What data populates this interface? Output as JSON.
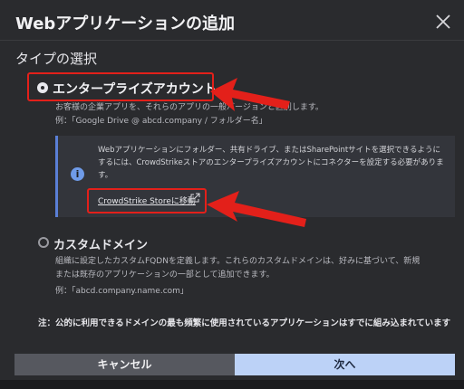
{
  "dialog": {
    "title": "Webアプリケーションの追加",
    "section_title": "タイプの選択",
    "close_icon": "close-icon"
  },
  "option_enterprise": {
    "label": "エンタープライズアカウント",
    "selected": true,
    "description": "お客様の企業アプリを、それらのアプリの一般バージョンと区別します。",
    "example": "例：「Google Drive @ abcd.company / フォルダー名」",
    "info": {
      "icon": "info-icon",
      "text": "Webアプリケーションにフォルダー、共有ドライブ、またはSharePointサイトを選択できるようにするには、CrowdStrikeストアのエンタープライズアカウントにコネクターを設定する必要があります。",
      "link_label": "CrowdStrike Storeに移動"
    }
  },
  "option_custom": {
    "label": "カスタムドメイン",
    "selected": false,
    "description_line1": "組織に設定したカスタムFQDNを定義します。これらのカスタムドメインは、好みに基づいて、新規",
    "description_line2": "または既存のアプリケーションの一部として追加できます。",
    "example": "例：「abcd.company.name.com」"
  },
  "note": "注：公的に利用できるドメインの最も頻繁に使用されているアプリケーションはすでに組み込まれています",
  "footer": {
    "cancel_label": "キャンセル",
    "next_label": "次へ"
  },
  "annotations": {
    "highlight_color": "#e3201a"
  }
}
